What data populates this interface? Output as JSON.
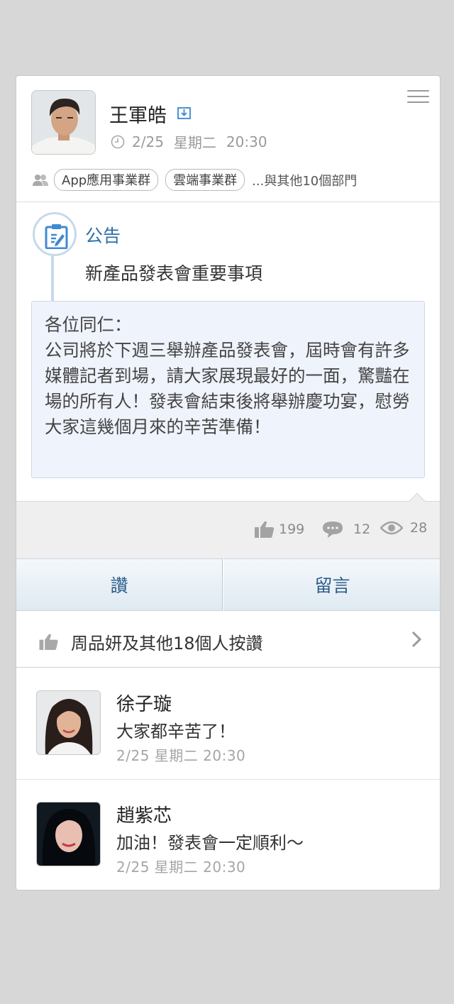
{
  "post": {
    "author": {
      "name": "王軍皓"
    },
    "date": "2/25",
    "weekday": "星期二",
    "time": "20:30",
    "departments": [
      "App應用事業群",
      "雲端事業群"
    ],
    "more_departments": "...與其他10個部門"
  },
  "announcement": {
    "label": "公告",
    "title": "新產品發表會重要事項",
    "body": "各位同仁：\n公司將於下週三舉辦產品發表會，屆時會有許多媒體記者到場，請大家展現最好的一面，驚豔在場的所有人！發表會結束後將舉辦慶功宴，慰勞大家這幾個月來的辛苦準備！"
  },
  "stats": {
    "likes": "199",
    "comments": "12",
    "views": "28"
  },
  "actions": {
    "like_label": "讚",
    "comment_label": "留言"
  },
  "likers": {
    "text": "周品妍及其他18個人按讚"
  },
  "comments": [
    {
      "name": "徐子璇",
      "text": "大家都辛苦了！",
      "timestamp": "2/25 星期二 20:30"
    },
    {
      "name": "趙紫芯",
      "text": "加油！發表會一定順利～",
      "timestamp": "2/25 星期二 20:30"
    }
  ],
  "colors": {
    "accent": "#2e6fa8",
    "background": "#d7d7d7",
    "announcement_bg": "#eff3fb"
  }
}
